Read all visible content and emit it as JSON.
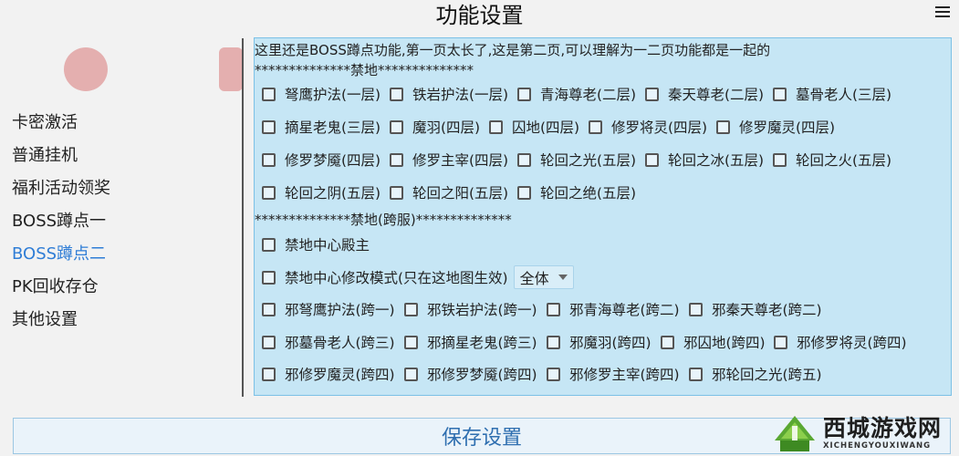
{
  "header": {
    "title": "功能设置",
    "menu_icon": "hamburger-menu-icon"
  },
  "sidebar": {
    "items": [
      {
        "label": "卡密激活",
        "active": false
      },
      {
        "label": "普通挂机",
        "active": false
      },
      {
        "label": "福利活动领奖",
        "active": false
      },
      {
        "label": "BOSS蹲点一",
        "active": false
      },
      {
        "label": "BOSS蹲点二",
        "active": true
      },
      {
        "label": "PK回收存仓",
        "active": false
      },
      {
        "label": "其他设置",
        "active": false
      }
    ],
    "active_color": "#2f7dd6"
  },
  "panel": {
    "intro": "这里还是BOSS蹲点功能,第一页太长了,这是第二页,可以理解为一二页功能都是一起的",
    "section1_title": "**************禁地**************",
    "section1_rows": [
      [
        "弩鹰护法(一层)",
        "铁岩护法(一层)",
        "青海尊老(二层)",
        "秦天尊老(二层)",
        "墓骨老人(三层)"
      ],
      [
        "摘星老鬼(三层)",
        "魔羽(四层)",
        "囚地(四层)",
        "修罗将灵(四层)",
        "修罗魔灵(四层)"
      ],
      [
        "修罗梦魇(四层)",
        "修罗主宰(四层)",
        "轮回之光(五层)",
        "轮回之冰(五层)",
        "轮回之火(五层)"
      ],
      [
        "轮回之阴(五层)",
        "轮回之阳(五层)",
        "轮回之绝(五层)"
      ]
    ],
    "section2_title": "**************禁地(跨服)**************",
    "boss_option": "禁地中心殿主",
    "mode_option": "禁地中心修改模式(只在这地图生效)",
    "mode_select_value": "全体",
    "section2_rows": [
      [
        "邪弩鹰护法(跨一)",
        "邪铁岩护法(跨一)",
        "邪青海尊老(跨二)",
        "邪秦天尊老(跨二)"
      ],
      [
        "邪墓骨老人(跨三)",
        "邪摘星老鬼(跨三)",
        "邪魔羽(跨四)",
        "邪囚地(跨四)",
        "邪修罗将灵(跨四)"
      ],
      [
        "邪修罗魔灵(跨四)",
        "邪修罗梦魇(跨四)",
        "邪修罗主宰(跨四)",
        "邪轮回之光(跨五)"
      ]
    ],
    "background": "#c6e6f5"
  },
  "footer": {
    "save_label": "保存设置"
  },
  "watermark": {
    "cn": "西城游戏网",
    "en": "XICHENGYOUXIWANG"
  }
}
